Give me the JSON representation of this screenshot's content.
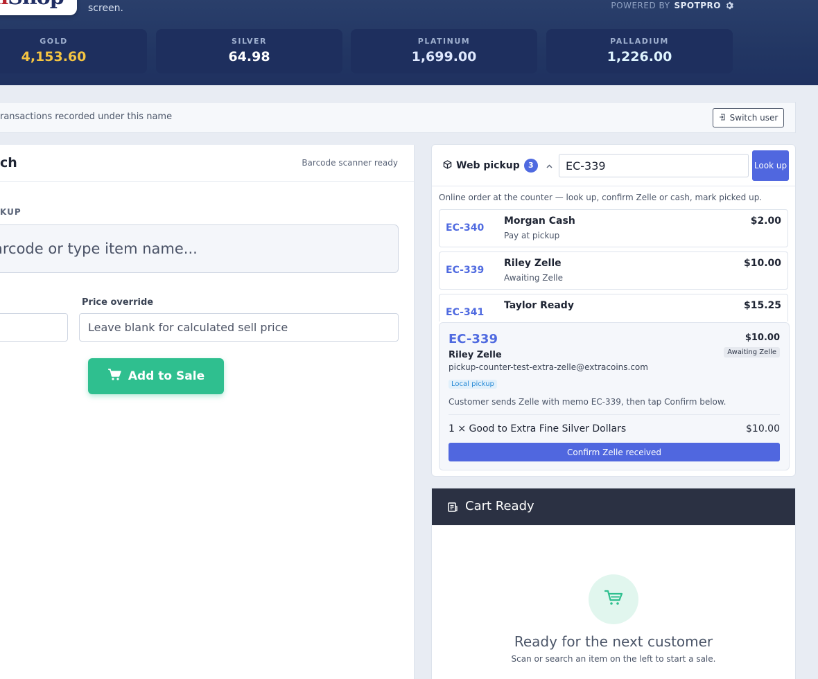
{
  "header": {
    "logo_prefix": "in",
    "logo_suffix": "Shop",
    "tagline": "screen.",
    "powered_label": "POWERED BY",
    "powered_brand": "SPOTPRO",
    "metals": [
      {
        "name": "GOLD",
        "price": "4,153.60",
        "color": "#f5c542"
      },
      {
        "name": "SILVER",
        "price": "64.98",
        "color": "#ffffff"
      },
      {
        "name": "PLATINUM",
        "price": "1,699.00",
        "color": "#dfe9ff"
      },
      {
        "name": "PALLADIUM",
        "price": "1,226.00",
        "color": "#dff5ff"
      }
    ]
  },
  "userbar": {
    "text": "ransactions recorded under this name",
    "switch_label": "Switch user"
  },
  "left": {
    "title": "ch",
    "status": "Barcode scanner ready",
    "section_label": "KUP",
    "scan_placeholder": "arcode or type item name...",
    "price_override_label": "Price override",
    "price_override_placeholder": "Leave blank for calculated sell price",
    "add_button": "Add to Sale"
  },
  "pickup": {
    "toggle_label": "Web pickup",
    "count": "3",
    "search_value": "EC-339",
    "lookup_button": "Look up",
    "description": "Online order at the counter — look up, confirm Zelle or cash, mark picked up.",
    "orders": [
      {
        "id": "EC-340",
        "name": "Morgan Cash",
        "status": "Pay at pickup",
        "amount": "$2.00"
      },
      {
        "id": "EC-339",
        "name": "Riley Zelle",
        "status": "Awaiting Zelle",
        "amount": "$10.00"
      },
      {
        "id": "EC-341",
        "name": "Taylor Ready",
        "status": "",
        "amount": "$15.25"
      }
    ],
    "detail": {
      "id": "EC-339",
      "name": "Riley Zelle",
      "amount": "$10.00",
      "status": "Awaiting Zelle",
      "email": "pickup-counter-test-extra-zelle@extracoins.com",
      "tag": "Local pickup",
      "instructions": "Customer sends Zelle with memo EC-339, then tap Confirm below.",
      "item": "1 × Good to Extra Fine Silver Dollars",
      "item_amount": "$10.00",
      "confirm_button": "Confirm Zelle received"
    }
  },
  "cart": {
    "title": "Cart Ready",
    "empty_title": "Ready for the next customer",
    "empty_sub": "Scan or search an item on the left to start a sale."
  },
  "colors": {
    "accent": "#4f6ae0",
    "success": "#2fbf8f",
    "header_bg": "#223663"
  }
}
